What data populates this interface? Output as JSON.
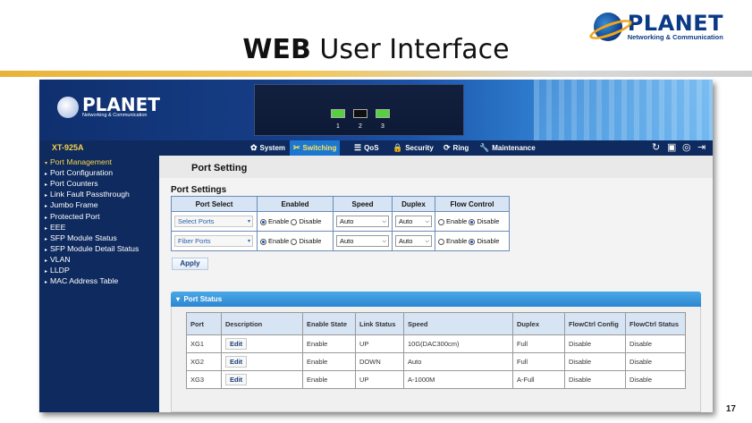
{
  "slide": {
    "title_bold": "WEB",
    "title_rest": " User Interface",
    "brand_name": "PLANET",
    "brand_tag": "Networking & Communication",
    "page_number": "17"
  },
  "banner": {
    "logo_name": "PLANET",
    "logo_tag": "Networking & Communication",
    "ports": [
      {
        "num": "1",
        "color": "#55d040"
      },
      {
        "num": "2",
        "color": "#101010"
      },
      {
        "num": "3",
        "color": "#55d040"
      }
    ]
  },
  "nav": {
    "device": "XT-925A",
    "items": [
      {
        "label": "System",
        "icon": "gear-icon",
        "glyph": "✿"
      },
      {
        "label": "Switching",
        "icon": "switching-icon",
        "glyph": "✂",
        "active": true
      },
      {
        "label": "QoS",
        "icon": "qos-icon",
        "glyph": "☰"
      },
      {
        "label": "Security",
        "icon": "lock-icon",
        "glyph": "🔒"
      },
      {
        "label": "Ring",
        "icon": "ring-icon",
        "glyph": "⟳"
      },
      {
        "label": "Maintenance",
        "icon": "wrench-icon",
        "glyph": "🔧"
      }
    ],
    "right_icons": [
      "refresh-icon",
      "save-icon",
      "help-icon",
      "logout-icon"
    ]
  },
  "sidebar": {
    "items": [
      {
        "label": "Port Management",
        "arrow": "▾",
        "active": true
      },
      {
        "label": "Port Configuration",
        "arrow": "▸"
      },
      {
        "label": "Port Counters",
        "arrow": "▸"
      },
      {
        "label": "Link Fault Passthrough",
        "arrow": "▸"
      },
      {
        "label": "Jumbo Frame",
        "arrow": "▸"
      },
      {
        "label": "Protected Port",
        "arrow": "▸"
      },
      {
        "label": "EEE",
        "arrow": "▸"
      },
      {
        "label": "SFP Module Status",
        "arrow": "▸"
      },
      {
        "label": "SFP Module Detail Status",
        "arrow": "▸"
      },
      {
        "label": "VLAN",
        "arrow": "▸"
      },
      {
        "label": "LLDP",
        "arrow": "▸"
      },
      {
        "label": "MAC Address Table",
        "arrow": "▸"
      }
    ]
  },
  "content": {
    "page_title": "Port Setting",
    "settings_label": "Port Settings",
    "settings_headers": [
      "Port Select",
      "Enabled",
      "Speed",
      "Duplex",
      "Flow Control"
    ],
    "settings_rows": [
      {
        "port": "Select Ports",
        "enable": "Enable",
        "disable": "Disable",
        "enabled": true,
        "speed": "Auto",
        "duplex": "Auto",
        "fc_enable": "Enable",
        "fc_disable": "Disable",
        "flow_enabled": false
      },
      {
        "port": "Fiber Ports",
        "enable": "Enable",
        "disable": "Disable",
        "enabled": true,
        "speed": "Auto",
        "duplex": "Auto",
        "fc_enable": "Enable",
        "fc_disable": "Disable",
        "flow_enabled": false
      }
    ],
    "apply_label": "Apply",
    "status_title": "Port Status",
    "status_headers": [
      "Port",
      "Description",
      "Enable State",
      "Link Status",
      "Speed",
      "Duplex",
      "FlowCtrl Config",
      "FlowCtrl Status"
    ],
    "status_rows": [
      {
        "port": "XG1",
        "edit": "Edit",
        "enable_state": "Enable",
        "link": "UP",
        "speed": "10G(DAC300cm)",
        "duplex": "Full",
        "fc_config": "Disable",
        "fc_status": "Disable"
      },
      {
        "port": "XG2",
        "edit": "Edit",
        "enable_state": "Enable",
        "link": "DOWN",
        "speed": "Auto",
        "duplex": "Full",
        "fc_config": "Disable",
        "fc_status": "Disable"
      },
      {
        "port": "XG3",
        "edit": "Edit",
        "enable_state": "Enable",
        "link": "UP",
        "speed": "A-1000M",
        "duplex": "A-Full",
        "fc_config": "Disable",
        "fc_status": "Disable"
      }
    ]
  }
}
